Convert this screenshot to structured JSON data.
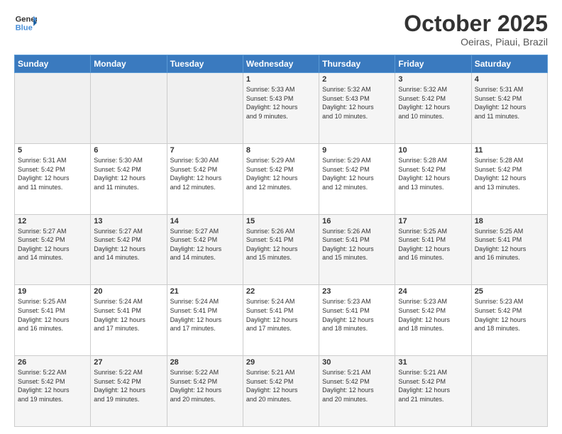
{
  "header": {
    "logo_line1": "General",
    "logo_line2": "Blue",
    "month": "October 2025",
    "location": "Oeiras, Piaui, Brazil"
  },
  "weekdays": [
    "Sunday",
    "Monday",
    "Tuesday",
    "Wednesday",
    "Thursday",
    "Friday",
    "Saturday"
  ],
  "weeks": [
    [
      {
        "day": "",
        "info": ""
      },
      {
        "day": "",
        "info": ""
      },
      {
        "day": "",
        "info": ""
      },
      {
        "day": "1",
        "info": "Sunrise: 5:33 AM\nSunset: 5:43 PM\nDaylight: 12 hours\nand 9 minutes."
      },
      {
        "day": "2",
        "info": "Sunrise: 5:32 AM\nSunset: 5:43 PM\nDaylight: 12 hours\nand 10 minutes."
      },
      {
        "day": "3",
        "info": "Sunrise: 5:32 AM\nSunset: 5:42 PM\nDaylight: 12 hours\nand 10 minutes."
      },
      {
        "day": "4",
        "info": "Sunrise: 5:31 AM\nSunset: 5:42 PM\nDaylight: 12 hours\nand 11 minutes."
      }
    ],
    [
      {
        "day": "5",
        "info": "Sunrise: 5:31 AM\nSunset: 5:42 PM\nDaylight: 12 hours\nand 11 minutes."
      },
      {
        "day": "6",
        "info": "Sunrise: 5:30 AM\nSunset: 5:42 PM\nDaylight: 12 hours\nand 11 minutes."
      },
      {
        "day": "7",
        "info": "Sunrise: 5:30 AM\nSunset: 5:42 PM\nDaylight: 12 hours\nand 12 minutes."
      },
      {
        "day": "8",
        "info": "Sunrise: 5:29 AM\nSunset: 5:42 PM\nDaylight: 12 hours\nand 12 minutes."
      },
      {
        "day": "9",
        "info": "Sunrise: 5:29 AM\nSunset: 5:42 PM\nDaylight: 12 hours\nand 12 minutes."
      },
      {
        "day": "10",
        "info": "Sunrise: 5:28 AM\nSunset: 5:42 PM\nDaylight: 12 hours\nand 13 minutes."
      },
      {
        "day": "11",
        "info": "Sunrise: 5:28 AM\nSunset: 5:42 PM\nDaylight: 12 hours\nand 13 minutes."
      }
    ],
    [
      {
        "day": "12",
        "info": "Sunrise: 5:27 AM\nSunset: 5:42 PM\nDaylight: 12 hours\nand 14 minutes."
      },
      {
        "day": "13",
        "info": "Sunrise: 5:27 AM\nSunset: 5:42 PM\nDaylight: 12 hours\nand 14 minutes."
      },
      {
        "day": "14",
        "info": "Sunrise: 5:27 AM\nSunset: 5:42 PM\nDaylight: 12 hours\nand 14 minutes."
      },
      {
        "day": "15",
        "info": "Sunrise: 5:26 AM\nSunset: 5:41 PM\nDaylight: 12 hours\nand 15 minutes."
      },
      {
        "day": "16",
        "info": "Sunrise: 5:26 AM\nSunset: 5:41 PM\nDaylight: 12 hours\nand 15 minutes."
      },
      {
        "day": "17",
        "info": "Sunrise: 5:25 AM\nSunset: 5:41 PM\nDaylight: 12 hours\nand 16 minutes."
      },
      {
        "day": "18",
        "info": "Sunrise: 5:25 AM\nSunset: 5:41 PM\nDaylight: 12 hours\nand 16 minutes."
      }
    ],
    [
      {
        "day": "19",
        "info": "Sunrise: 5:25 AM\nSunset: 5:41 PM\nDaylight: 12 hours\nand 16 minutes."
      },
      {
        "day": "20",
        "info": "Sunrise: 5:24 AM\nSunset: 5:41 PM\nDaylight: 12 hours\nand 17 minutes."
      },
      {
        "day": "21",
        "info": "Sunrise: 5:24 AM\nSunset: 5:41 PM\nDaylight: 12 hours\nand 17 minutes."
      },
      {
        "day": "22",
        "info": "Sunrise: 5:24 AM\nSunset: 5:41 PM\nDaylight: 12 hours\nand 17 minutes."
      },
      {
        "day": "23",
        "info": "Sunrise: 5:23 AM\nSunset: 5:41 PM\nDaylight: 12 hours\nand 18 minutes."
      },
      {
        "day": "24",
        "info": "Sunrise: 5:23 AM\nSunset: 5:42 PM\nDaylight: 12 hours\nand 18 minutes."
      },
      {
        "day": "25",
        "info": "Sunrise: 5:23 AM\nSunset: 5:42 PM\nDaylight: 12 hours\nand 18 minutes."
      }
    ],
    [
      {
        "day": "26",
        "info": "Sunrise: 5:22 AM\nSunset: 5:42 PM\nDaylight: 12 hours\nand 19 minutes."
      },
      {
        "day": "27",
        "info": "Sunrise: 5:22 AM\nSunset: 5:42 PM\nDaylight: 12 hours\nand 19 minutes."
      },
      {
        "day": "28",
        "info": "Sunrise: 5:22 AM\nSunset: 5:42 PM\nDaylight: 12 hours\nand 20 minutes."
      },
      {
        "day": "29",
        "info": "Sunrise: 5:21 AM\nSunset: 5:42 PM\nDaylight: 12 hours\nand 20 minutes."
      },
      {
        "day": "30",
        "info": "Sunrise: 5:21 AM\nSunset: 5:42 PM\nDaylight: 12 hours\nand 20 minutes."
      },
      {
        "day": "31",
        "info": "Sunrise: 5:21 AM\nSunset: 5:42 PM\nDaylight: 12 hours\nand 21 minutes."
      },
      {
        "day": "",
        "info": ""
      }
    ]
  ]
}
